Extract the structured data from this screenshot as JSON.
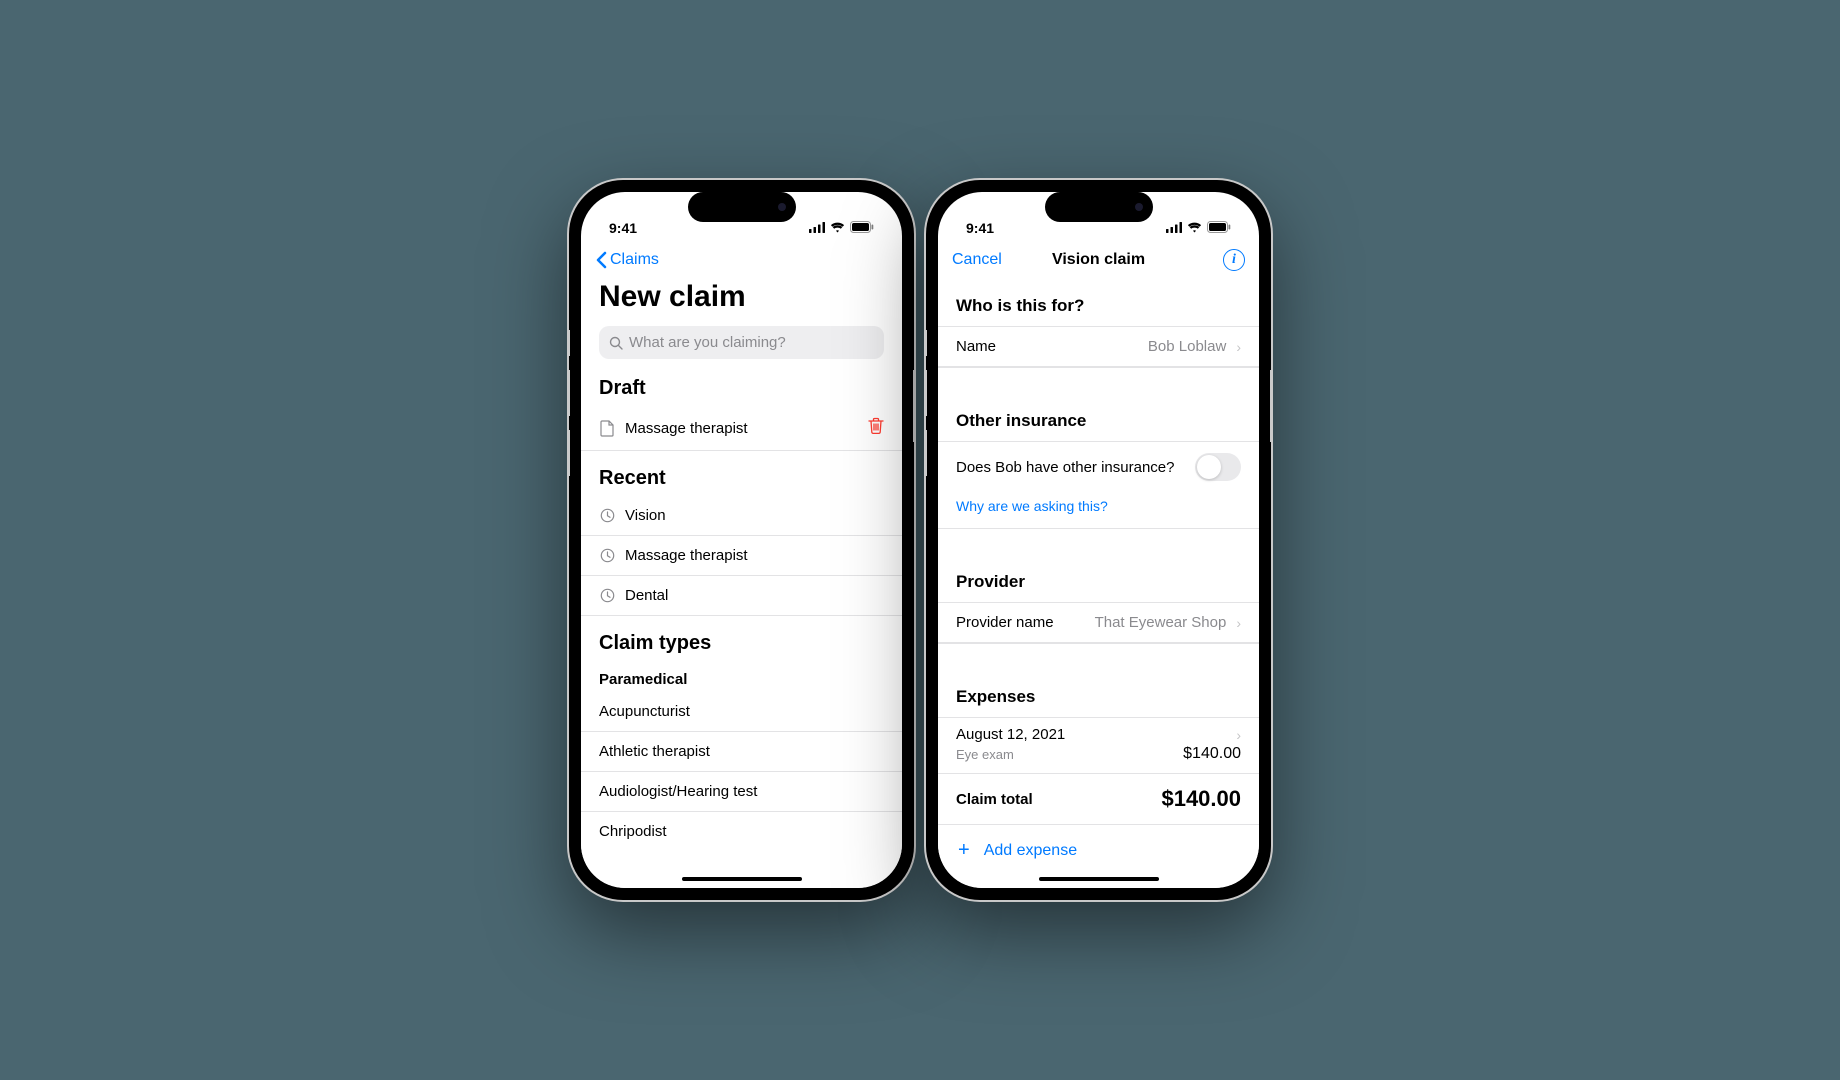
{
  "status_time": "9:41",
  "left": {
    "back_label": "Claims",
    "title": "New claim",
    "search_placeholder": "What are you claiming?",
    "draft_header": "Draft",
    "draft_item": "Massage therapist",
    "recent_header": "Recent",
    "recent": [
      "Vision",
      "Massage therapist",
      "Dental"
    ],
    "types_header": "Claim types",
    "types_subheader": "Paramedical",
    "types": [
      "Acupuncturist",
      "Athletic therapist",
      "Audiologist/Hearing test",
      "Chripodist"
    ]
  },
  "right": {
    "cancel": "Cancel",
    "title": "Vision claim",
    "who_header": "Who is this for?",
    "name_label": "Name",
    "name_value": "Bob Loblaw",
    "other_ins_header": "Other insurance",
    "other_ins_question": "Does Bob have other insurance?",
    "why_link": "Why are we asking this?",
    "provider_header": "Provider",
    "provider_label": "Provider name",
    "provider_value": "That Eyewear Shop",
    "expenses_header": "Expenses",
    "expense_date": "August 12, 2021",
    "expense_item": "Eye exam",
    "expense_amount": "$140.00",
    "total_label": "Claim total",
    "total_value": "$140.00",
    "add_expense": "Add expense"
  }
}
